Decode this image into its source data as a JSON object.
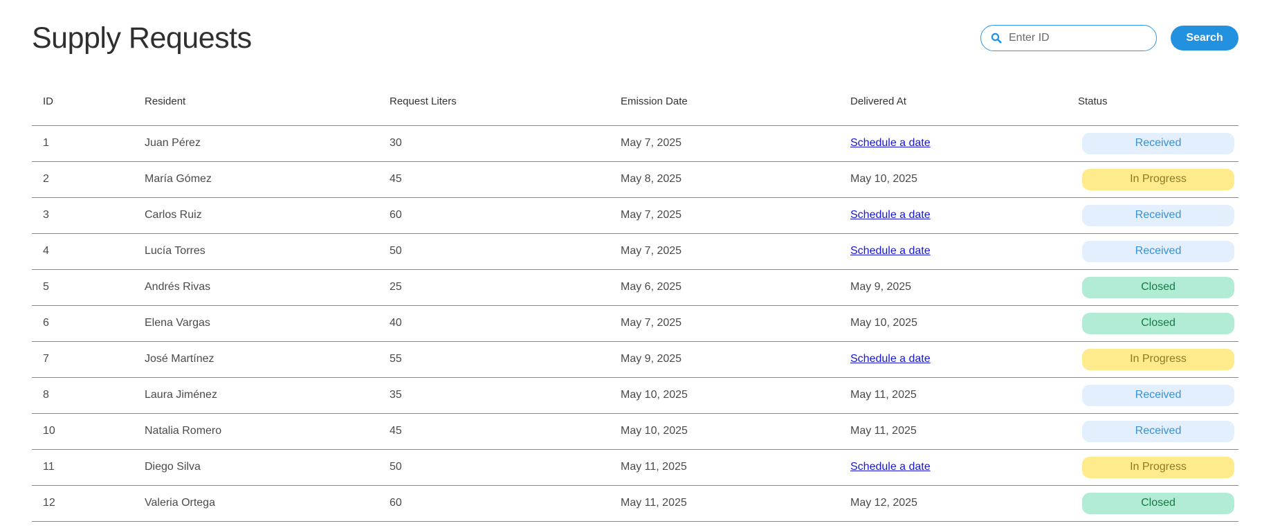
{
  "header": {
    "title": "Supply Requests",
    "search": {
      "placeholder": "Enter ID",
      "value": ""
    },
    "search_button": "Search"
  },
  "table": {
    "columns": [
      "ID",
      "Resident",
      "Request Liters",
      "Emission Date",
      "Delivered At",
      "Status"
    ],
    "schedule_link_label": "Schedule a date",
    "status_colors": {
      "Received": {
        "bg": "#e3effc",
        "fg": "#3a8fd6"
      },
      "In Progress": {
        "bg": "#fdeb8c",
        "fg": "#8d7a20"
      },
      "Closed": {
        "bg": "#b3ecd5",
        "fg": "#167844"
      }
    },
    "rows": [
      {
        "id": "1",
        "resident": "Juan Pérez",
        "liters": "30",
        "emission": "May 7, 2025",
        "delivered": null,
        "status": "Received"
      },
      {
        "id": "2",
        "resident": "María Gómez",
        "liters": "45",
        "emission": "May 8, 2025",
        "delivered": "May 10, 2025",
        "status": "In Progress"
      },
      {
        "id": "3",
        "resident": "Carlos Ruiz",
        "liters": "60",
        "emission": "May 7, 2025",
        "delivered": null,
        "status": "Received"
      },
      {
        "id": "4",
        "resident": "Lucía Torres",
        "liters": "50",
        "emission": "May 7, 2025",
        "delivered": null,
        "status": "Received"
      },
      {
        "id": "5",
        "resident": "Andrés Rivas",
        "liters": "25",
        "emission": "May 6, 2025",
        "delivered": "May 9, 2025",
        "status": "Closed"
      },
      {
        "id": "6",
        "resident": "Elena Vargas",
        "liters": "40",
        "emission": "May 7, 2025",
        "delivered": "May 10, 2025",
        "status": "Closed"
      },
      {
        "id": "7",
        "resident": "José Martínez",
        "liters": "55",
        "emission": "May 9, 2025",
        "delivered": null,
        "status": "In Progress"
      },
      {
        "id": "8",
        "resident": "Laura Jiménez",
        "liters": "35",
        "emission": "May 10, 2025",
        "delivered": "May 11, 2025",
        "status": "Received"
      },
      {
        "id": "10",
        "resident": "Natalia Romero",
        "liters": "45",
        "emission": "May 10, 2025",
        "delivered": "May 11, 2025",
        "status": "Received"
      },
      {
        "id": "11",
        "resident": "Diego Silva",
        "liters": "50",
        "emission": "May 11, 2025",
        "delivered": null,
        "status": "In Progress"
      },
      {
        "id": "12",
        "resident": "Valeria Ortega",
        "liters": "60",
        "emission": "May 11, 2025",
        "delivered": "May 12, 2025",
        "status": "Closed"
      }
    ]
  }
}
